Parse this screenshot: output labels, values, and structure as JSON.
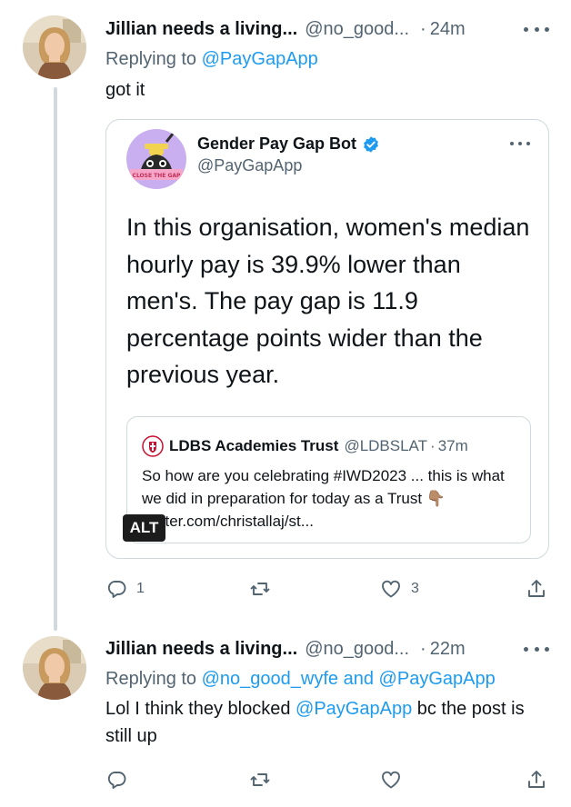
{
  "tweets": [
    {
      "author": "Jillian needs a living...",
      "handle": "@no_good...",
      "time": "24m",
      "replying_prefix": "Replying to",
      "replying_to": "@PayGapApp",
      "text": "got it",
      "actions": {
        "reply_count": "1",
        "repost_count": "",
        "like_count": "3"
      }
    },
    {
      "author": "Jillian needs a living...",
      "handle": "@no_good...",
      "time": "22m",
      "replying_prefix": "Replying to",
      "replying_to_1": "@no_good_wyfe",
      "replying_and": "and",
      "replying_to_2": "@PayGapApp",
      "text_part1": "Lol I think they blocked",
      "text_mention": "@PayGapApp",
      "text_part2": "bc the post is still up",
      "actions": {
        "reply_count": "",
        "repost_count": "",
        "like_count": ""
      }
    }
  ],
  "quote": {
    "author": "Gender Pay Gap Bot",
    "handle": "@PayGapApp",
    "avatar_banner": "CLOSE THE GAP",
    "text": "In this organisation, women's median hourly pay is 39.9% lower than men's. The pay gap is 11.9 percentage points wider than the previous year.",
    "alt_label": "ALT",
    "inner": {
      "author": "LDBS Academies Trust",
      "handle": "@LDBSLAT",
      "time": "37m",
      "text": "So how are you celebrating #IWD2023 ... this is what we did in preparation for today as a Trust 👇🏽 twitter.com/christallaj/st..."
    }
  },
  "separator": "·",
  "colors": {
    "text": "#0f1419",
    "secondary": "#536471",
    "link": "#1d9bf0",
    "border": "#cfd9de",
    "verified": "#1d9bf0"
  },
  "icons": [
    "more-icon",
    "verified-badge-icon",
    "reply-icon",
    "repost-icon",
    "like-icon",
    "share-icon"
  ]
}
